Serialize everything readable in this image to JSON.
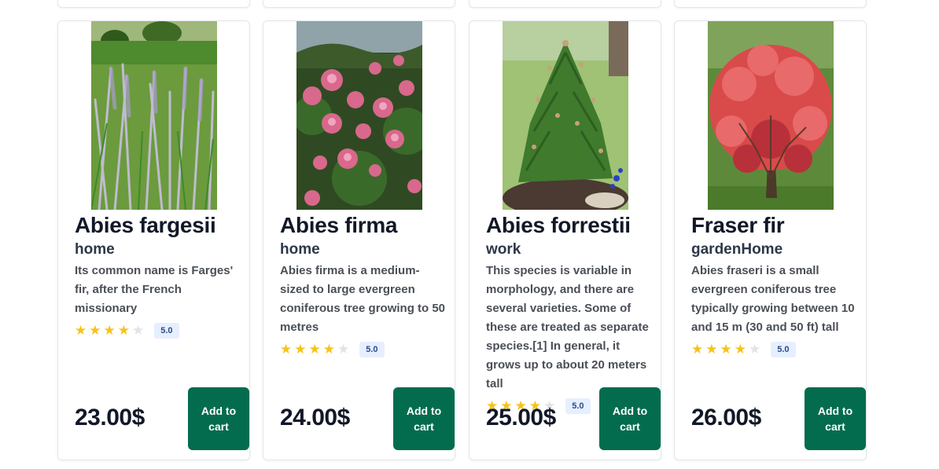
{
  "products": [
    {
      "title": "Abies fargesii",
      "category": "home",
      "description": "Its common name is Farges' fir, after the French missionary",
      "rating": 4,
      "rating_max": 5,
      "badge": "5.0",
      "price": "23.00$",
      "button": "Add to cart",
      "image_icon": "ornamental-grass-photo"
    },
    {
      "title": "Abies firma",
      "category": "home",
      "description": "Abies firma is a medium-sized to large evergreen coniferous tree growing to 50 metres",
      "rating": 4,
      "rating_max": 5,
      "badge": "5.0",
      "price": "24.00$",
      "button": "Add to cart",
      "image_icon": "pink-roses-photo"
    },
    {
      "title": "Abies forrestii",
      "category": "work",
      "description": "This species is variable in morphology, and there are several varieties. Some of these are treated as separate species.[1] In general, it grows up to about 20 meters tall",
      "rating": 4,
      "rating_max": 5,
      "badge": "5.0",
      "price": "25.00$",
      "button": "Add to cart",
      "image_icon": "pine-shrub-photo"
    },
    {
      "title": "Fraser fir",
      "category": "gardenHome",
      "description": "Abies fraseri is a small evergreen coniferous tree typically growing between 10 and 15 m (30 and 50 ft) tall",
      "rating": 4,
      "rating_max": 5,
      "badge": "5.0",
      "price": "26.00$",
      "button": "Add to cart",
      "image_icon": "red-maple-photo"
    }
  ],
  "colors": {
    "button": "#046c4e",
    "star": "#f6c31a",
    "badge_bg": "#e6efff"
  }
}
